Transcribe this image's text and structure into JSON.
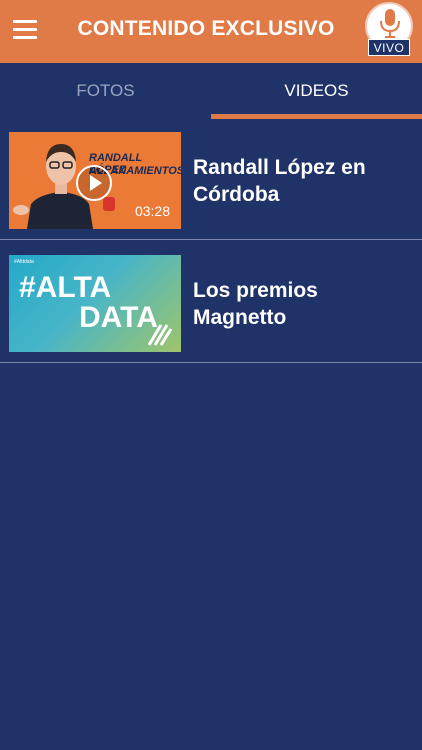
{
  "header": {
    "title": "CONTENIDO EXCLUSIVO",
    "live_badge": "VIVO",
    "menu_icon": "hamburger-menu-icon",
    "mic_icon": "microphone-icon"
  },
  "tabs": [
    {
      "label": "FOTOS",
      "active": false
    },
    {
      "label": "VIDEOS",
      "active": true
    }
  ],
  "videos": [
    {
      "title": "Randall López en Córdoba",
      "thumbnail_text_1": "RANDALL LÓPEZ",
      "thumbnail_text_2": "ALLANAMIENTOS",
      "duration": "03:28",
      "icon": "play-icon"
    },
    {
      "title": "Los premios Magnetto",
      "thumbnail_text_1": "#ALTA",
      "thumbnail_text_2": "DATA",
      "thumbnail_small": "#Alttdata"
    }
  ],
  "colors": {
    "header": "#e07a47",
    "background": "#1f3369",
    "accent": "#e07a47"
  }
}
